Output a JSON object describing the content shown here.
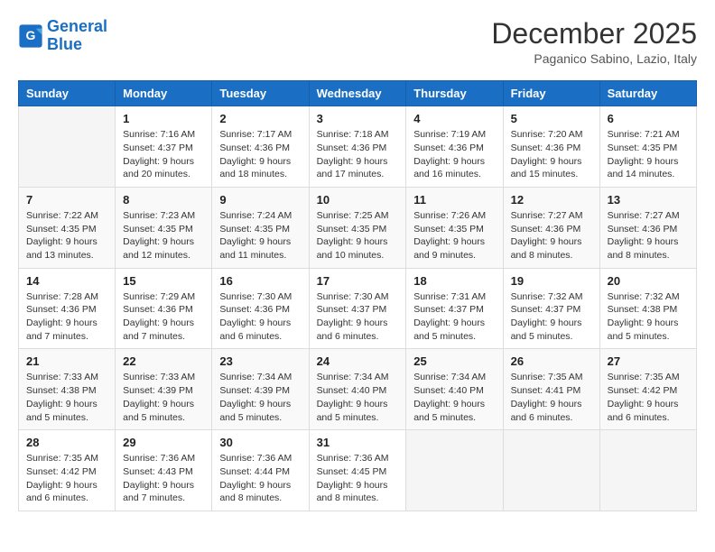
{
  "header": {
    "logo_line1": "General",
    "logo_line2": "Blue",
    "month_title": "December 2025",
    "location": "Paganico Sabino, Lazio, Italy"
  },
  "weekdays": [
    "Sunday",
    "Monday",
    "Tuesday",
    "Wednesday",
    "Thursday",
    "Friday",
    "Saturday"
  ],
  "weeks": [
    [
      {
        "day": "",
        "info": ""
      },
      {
        "day": "1",
        "info": "Sunrise: 7:16 AM\nSunset: 4:37 PM\nDaylight: 9 hours\nand 20 minutes."
      },
      {
        "day": "2",
        "info": "Sunrise: 7:17 AM\nSunset: 4:36 PM\nDaylight: 9 hours\nand 18 minutes."
      },
      {
        "day": "3",
        "info": "Sunrise: 7:18 AM\nSunset: 4:36 PM\nDaylight: 9 hours\nand 17 minutes."
      },
      {
        "day": "4",
        "info": "Sunrise: 7:19 AM\nSunset: 4:36 PM\nDaylight: 9 hours\nand 16 minutes."
      },
      {
        "day": "5",
        "info": "Sunrise: 7:20 AM\nSunset: 4:36 PM\nDaylight: 9 hours\nand 15 minutes."
      },
      {
        "day": "6",
        "info": "Sunrise: 7:21 AM\nSunset: 4:35 PM\nDaylight: 9 hours\nand 14 minutes."
      }
    ],
    [
      {
        "day": "7",
        "info": "Sunrise: 7:22 AM\nSunset: 4:35 PM\nDaylight: 9 hours\nand 13 minutes."
      },
      {
        "day": "8",
        "info": "Sunrise: 7:23 AM\nSunset: 4:35 PM\nDaylight: 9 hours\nand 12 minutes."
      },
      {
        "day": "9",
        "info": "Sunrise: 7:24 AM\nSunset: 4:35 PM\nDaylight: 9 hours\nand 11 minutes."
      },
      {
        "day": "10",
        "info": "Sunrise: 7:25 AM\nSunset: 4:35 PM\nDaylight: 9 hours\nand 10 minutes."
      },
      {
        "day": "11",
        "info": "Sunrise: 7:26 AM\nSunset: 4:35 PM\nDaylight: 9 hours\nand 9 minutes."
      },
      {
        "day": "12",
        "info": "Sunrise: 7:27 AM\nSunset: 4:36 PM\nDaylight: 9 hours\nand 8 minutes."
      },
      {
        "day": "13",
        "info": "Sunrise: 7:27 AM\nSunset: 4:36 PM\nDaylight: 9 hours\nand 8 minutes."
      }
    ],
    [
      {
        "day": "14",
        "info": "Sunrise: 7:28 AM\nSunset: 4:36 PM\nDaylight: 9 hours\nand 7 minutes."
      },
      {
        "day": "15",
        "info": "Sunrise: 7:29 AM\nSunset: 4:36 PM\nDaylight: 9 hours\nand 7 minutes."
      },
      {
        "day": "16",
        "info": "Sunrise: 7:30 AM\nSunset: 4:36 PM\nDaylight: 9 hours\nand 6 minutes."
      },
      {
        "day": "17",
        "info": "Sunrise: 7:30 AM\nSunset: 4:37 PM\nDaylight: 9 hours\nand 6 minutes."
      },
      {
        "day": "18",
        "info": "Sunrise: 7:31 AM\nSunset: 4:37 PM\nDaylight: 9 hours\nand 5 minutes."
      },
      {
        "day": "19",
        "info": "Sunrise: 7:32 AM\nSunset: 4:37 PM\nDaylight: 9 hours\nand 5 minutes."
      },
      {
        "day": "20",
        "info": "Sunrise: 7:32 AM\nSunset: 4:38 PM\nDaylight: 9 hours\nand 5 minutes."
      }
    ],
    [
      {
        "day": "21",
        "info": "Sunrise: 7:33 AM\nSunset: 4:38 PM\nDaylight: 9 hours\nand 5 minutes."
      },
      {
        "day": "22",
        "info": "Sunrise: 7:33 AM\nSunset: 4:39 PM\nDaylight: 9 hours\nand 5 minutes."
      },
      {
        "day": "23",
        "info": "Sunrise: 7:34 AM\nSunset: 4:39 PM\nDaylight: 9 hours\nand 5 minutes."
      },
      {
        "day": "24",
        "info": "Sunrise: 7:34 AM\nSunset: 4:40 PM\nDaylight: 9 hours\nand 5 minutes."
      },
      {
        "day": "25",
        "info": "Sunrise: 7:34 AM\nSunset: 4:40 PM\nDaylight: 9 hours\nand 5 minutes."
      },
      {
        "day": "26",
        "info": "Sunrise: 7:35 AM\nSunset: 4:41 PM\nDaylight: 9 hours\nand 6 minutes."
      },
      {
        "day": "27",
        "info": "Sunrise: 7:35 AM\nSunset: 4:42 PM\nDaylight: 9 hours\nand 6 minutes."
      }
    ],
    [
      {
        "day": "28",
        "info": "Sunrise: 7:35 AM\nSunset: 4:42 PM\nDaylight: 9 hours\nand 6 minutes."
      },
      {
        "day": "29",
        "info": "Sunrise: 7:36 AM\nSunset: 4:43 PM\nDaylight: 9 hours\nand 7 minutes."
      },
      {
        "day": "30",
        "info": "Sunrise: 7:36 AM\nSunset: 4:44 PM\nDaylight: 9 hours\nand 8 minutes."
      },
      {
        "day": "31",
        "info": "Sunrise: 7:36 AM\nSunset: 4:45 PM\nDaylight: 9 hours\nand 8 minutes."
      },
      {
        "day": "",
        "info": ""
      },
      {
        "day": "",
        "info": ""
      },
      {
        "day": "",
        "info": ""
      }
    ]
  ]
}
